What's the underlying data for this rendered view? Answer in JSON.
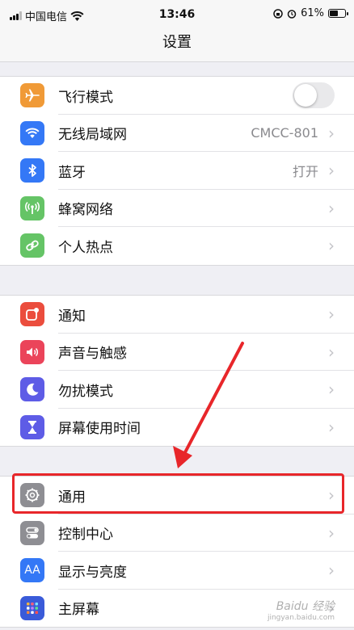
{
  "status_bar": {
    "carrier": "中国电信",
    "time": "13:46",
    "battery_percent": "61%",
    "battery_level": 0.61,
    "icons": [
      "signal-icon",
      "wifi-icon",
      "orientation-lock-icon",
      "alarm-icon",
      "battery-icon"
    ]
  },
  "nav": {
    "title": "设置"
  },
  "groups": [
    {
      "rows": [
        {
          "label": "飞行模式",
          "icon": "airplane-icon",
          "color": "#f09a37",
          "control": "toggle",
          "toggle_on": false
        },
        {
          "label": "无线局域网",
          "icon": "wifi-icon",
          "color": "#3478f6",
          "value": "CMCC-801"
        },
        {
          "label": "蓝牙",
          "icon": "bluetooth-icon",
          "color": "#3478f6",
          "value": "打开"
        },
        {
          "label": "蜂窝网络",
          "icon": "cellular-icon",
          "color": "#65c466"
        },
        {
          "label": "个人热点",
          "icon": "hotspot-icon",
          "color": "#65c466"
        }
      ]
    },
    {
      "rows": [
        {
          "label": "通知",
          "icon": "notifications-icon",
          "color": "#eb4d3d"
        },
        {
          "label": "声音与触感",
          "icon": "sounds-icon",
          "color": "#eb445a"
        },
        {
          "label": "勿扰模式",
          "icon": "moon-icon",
          "color": "#5e5ce6"
        },
        {
          "label": "屏幕使用时间",
          "icon": "hourglass-icon",
          "color": "#5e5ce6"
        }
      ]
    },
    {
      "rows": [
        {
          "label": "通用",
          "icon": "gear-icon",
          "color": "#8e8e93"
        },
        {
          "label": "控制中心",
          "icon": "control-center-icon",
          "color": "#8e8e93"
        },
        {
          "label": "显示与亮度",
          "icon": "display-icon",
          "color": "#3478f6",
          "icon_text": "AA"
        },
        {
          "label": "主屏幕",
          "icon": "home-screen-icon",
          "color": "#3a5bd9"
        }
      ]
    }
  ],
  "annotation": {
    "highlight_color": "#e8262a"
  },
  "watermark": {
    "text": "Baidu 经验",
    "sub": "jingyan.baidu.com"
  }
}
